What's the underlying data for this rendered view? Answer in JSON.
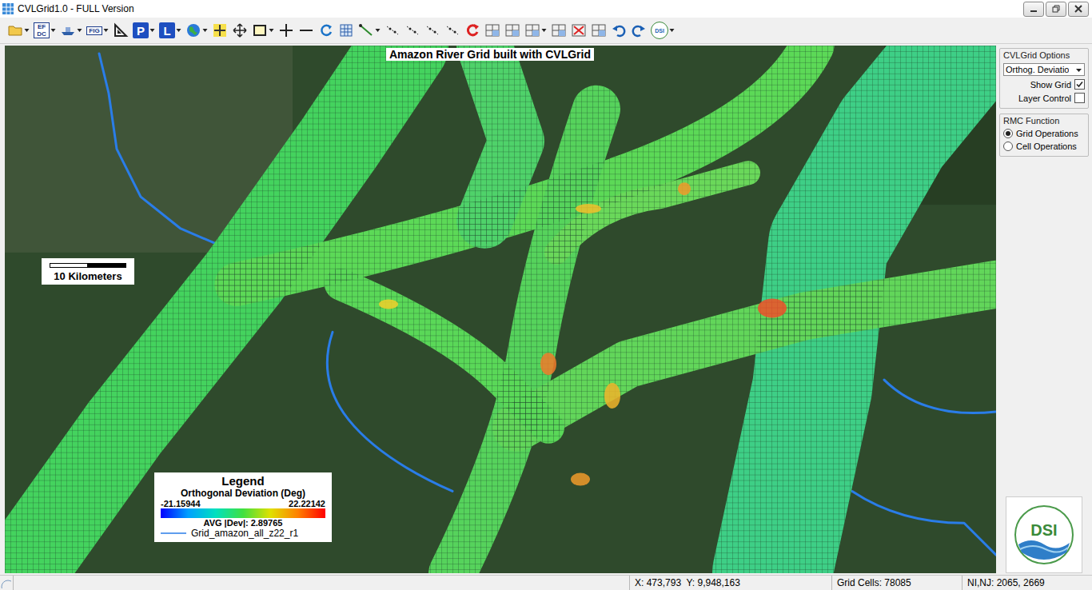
{
  "window": {
    "title": "CVLGrid1.0 - FULL Version"
  },
  "toolbar": [
    {
      "kind": "folder",
      "dropdown": true
    },
    {
      "kind": "text-icon",
      "label": "EF DC",
      "dropdown": true
    },
    {
      "kind": "ship",
      "dropdown": true
    },
    {
      "kind": "text-icon",
      "label": "FIG",
      "dropdown": true
    },
    {
      "kind": "triangle",
      "dropdown": false
    },
    {
      "kind": "letter",
      "label": "P",
      "dropdown": true
    },
    {
      "kind": "letter",
      "label": "L",
      "dropdown": true
    },
    {
      "kind": "globe",
      "dropdown": true
    },
    {
      "kind": "crosshair",
      "dropdown": false
    },
    {
      "kind": "move",
      "dropdown": false
    },
    {
      "kind": "rect",
      "dropdown": true
    },
    {
      "kind": "plus",
      "dropdown": false
    },
    {
      "kind": "minus",
      "dropdown": false
    },
    {
      "kind": "refresh",
      "dropdown": false
    },
    {
      "kind": "grid",
      "dropdown": false
    },
    {
      "kind": "line",
      "dropdown": true
    },
    {
      "kind": "node",
      "dropdown": false
    },
    {
      "kind": "node",
      "dropdown": false
    },
    {
      "kind": "node",
      "dropdown": false
    },
    {
      "kind": "node",
      "dropdown": false
    },
    {
      "kind": "reload",
      "dropdown": false
    },
    {
      "kind": "grid-op",
      "dropdown": false
    },
    {
      "kind": "grid-op",
      "dropdown": false
    },
    {
      "kind": "grid-op",
      "dropdown": true
    },
    {
      "kind": "grid-op",
      "dropdown": false
    },
    {
      "kind": "grid-delete",
      "dropdown": false
    },
    {
      "kind": "grid-op",
      "dropdown": false
    },
    {
      "kind": "undo",
      "dropdown": false
    },
    {
      "kind": "redo",
      "dropdown": false
    },
    {
      "kind": "dsi",
      "label": "DSI",
      "dropdown": true
    }
  ],
  "map": {
    "title": "Amazon River Grid built with CVLGrid",
    "scale_label": "10 Kilometers",
    "legend": {
      "title": "Legend",
      "subtitle": "Orthogonal Deviation (Deg)",
      "min": "-21.15944",
      "max": "22.22142",
      "average": "AVG |Dev|: 2.89765",
      "layer": "Grid_amazon_all_z22_r1"
    }
  },
  "options_panel": {
    "title": "CVLGrid Options",
    "dropdown": "Orthog. Deviatio",
    "checkboxes": [
      {
        "label": "Show Grid",
        "checked": true
      },
      {
        "label": "Layer Control",
        "checked": false
      }
    ]
  },
  "rmc_panel": {
    "title": "RMC Function",
    "options": [
      {
        "label": "Grid Operations",
        "selected": true
      },
      {
        "label": "Cell Operations",
        "selected": false
      }
    ]
  },
  "logo": {
    "text": "DSI"
  },
  "status_bar": {
    "coordinates": "X: 473,793  Y: 9,948,163",
    "grid_cells": "Grid Cells: 78085",
    "ni_nj": "NI,NJ: 2065, 2669"
  }
}
